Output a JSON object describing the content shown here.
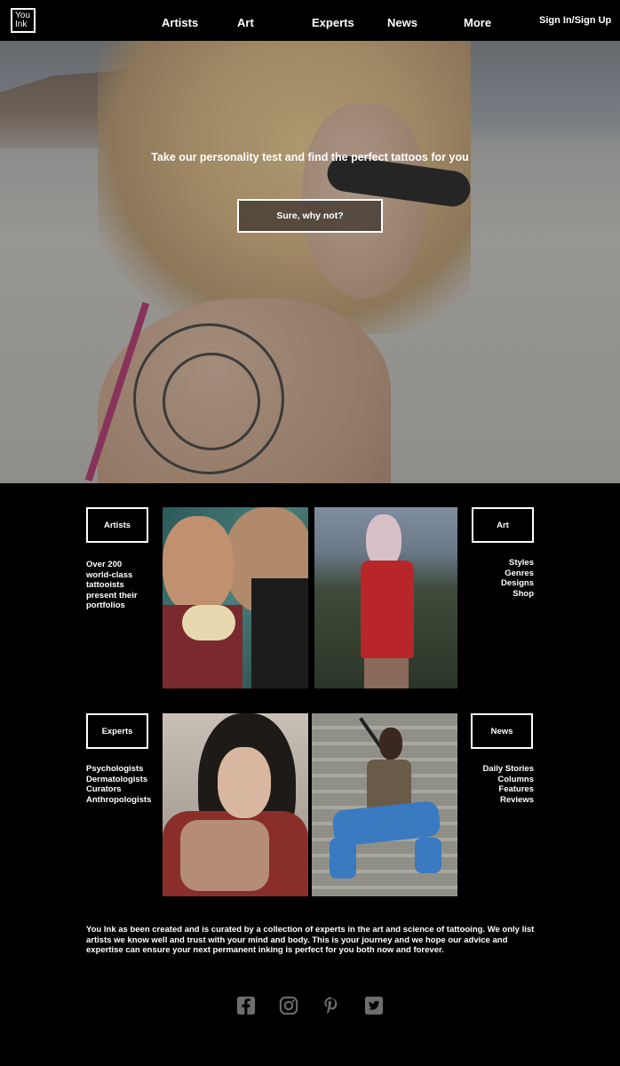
{
  "header": {
    "logo_line1": "You",
    "logo_line2": "Ink",
    "nav": [
      "Artists",
      "Art",
      "Experts",
      "News",
      "More"
    ],
    "signin": "Sign In/Sign Up"
  },
  "hero": {
    "text": "Take our personality test and find the perfect tattoos for you",
    "cta": "Sure, why not?"
  },
  "sections": {
    "artists": {
      "label": "Artists",
      "desc": [
        "Over 200",
        "world-class",
        "tattooists",
        "present their",
        "portfolios"
      ]
    },
    "art": {
      "label": "Art",
      "desc": [
        "Styles",
        "Genres",
        "Designs",
        "Shop"
      ]
    },
    "experts": {
      "label": "Experts",
      "desc": [
        "Psychologists",
        "Dermatologists",
        "Curators",
        "Anthropologists"
      ]
    },
    "news": {
      "label": "News",
      "desc": [
        "Daily Stories",
        "Columns",
        "Features",
        "Reviews"
      ]
    }
  },
  "footer": {
    "about": "You Ink as been created and is curated by a collection of experts in the art and science of tattooing. We only list artists we know well and trust with your mind and body. This is your journey and we hope our advice and expertise can ensure your next permanent inking is perfect for you both now and forever.",
    "social": [
      "facebook-icon",
      "instagram-icon",
      "pinterest-icon",
      "twitter-icon"
    ],
    "icon_color": "#6e6e6e"
  }
}
